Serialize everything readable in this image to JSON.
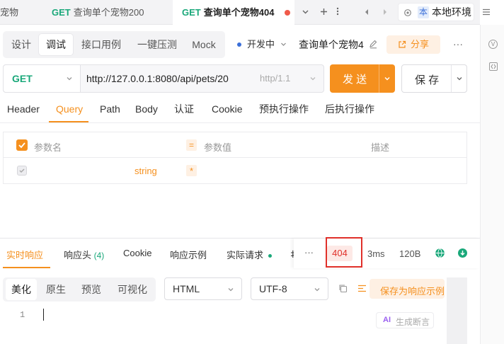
{
  "tabs": [
    {
      "method": "",
      "title": "宠物"
    },
    {
      "method": "GET",
      "title": "查询单个宠物200"
    },
    {
      "method": "GET",
      "title": "查询单个宠物404"
    }
  ],
  "environment": {
    "badge": "本",
    "label": "本地环境"
  },
  "modes": [
    "设计",
    "调试",
    "接口用例",
    "一键压测",
    "Mock"
  ],
  "status_label": "开发中",
  "endpoint_name": "查询单个宠物4",
  "share_label": "分享",
  "request": {
    "method": "GET",
    "url": "http://127.0.0.1:8080/api/pets/20",
    "protocol": "http/1.1",
    "send_label": "发 送",
    "save_label": "保 存"
  },
  "param_tabs": [
    "Header",
    "Query",
    "Path",
    "Body",
    "认证",
    "Cookie",
    "预执行操作",
    "后执行操作"
  ],
  "param_table": {
    "col_name": "参数名",
    "col_value": "参数值",
    "col_desc": "描述",
    "equals": "=",
    "row_type": "string",
    "row_required": "*"
  },
  "response_tabs": {
    "realtime": "实时响应",
    "headers": "响应头",
    "headers_count": "(4)",
    "cookie": "Cookie",
    "example": "响应示例",
    "actual": "实际请求"
  },
  "response_meta": {
    "more": "···",
    "status_code": "404",
    "time": "3ms",
    "size": "120B"
  },
  "view_modes": [
    "美化",
    "原生",
    "预览",
    "可视化"
  ],
  "format_select": "HTML",
  "encoding_select": "UTF-8",
  "save_as_example": "保存为响应示例",
  "editor": {
    "line_number": "1",
    "ai_badge": "AI",
    "ai_label": "生成断言"
  },
  "colors": {
    "accent": "#f5901e",
    "get_green": "#1aa87a",
    "highlight_red": "#e0302a",
    "status_bg": "#fde9e6"
  }
}
